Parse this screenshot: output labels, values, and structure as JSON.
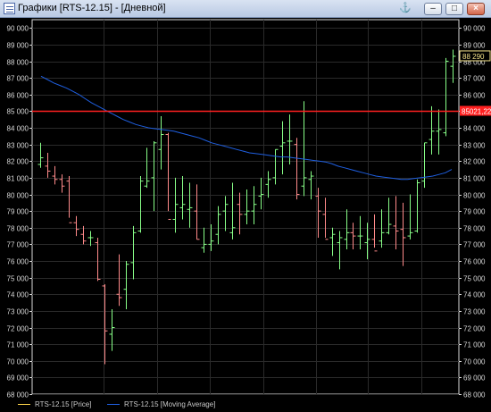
{
  "window": {
    "title": "Графики [RTS-12.15] - [Дневной]",
    "controls": {
      "anchor_icon": "anchor-icon",
      "minimize_icon": "minimize-icon",
      "restore_icon": "restore-icon",
      "close_icon": "close-icon"
    }
  },
  "colors": {
    "background": "#000000",
    "grid": "#2a2a2a",
    "axis": "#d8d8d8",
    "up": "#88ff88",
    "down": "#ff8a8a",
    "ma": "#1f5fe0",
    "level": "#ff2020"
  },
  "chart_data": {
    "type": "bar",
    "title": "",
    "ylim": [
      68000,
      90500
    ],
    "y_ticks": [
      "68 000",
      "69 000",
      "70 000",
      "71 000",
      "72 000",
      "73 000",
      "74 000",
      "75 000",
      "76 000",
      "77 000",
      "78 000",
      "79 000",
      "80 000",
      "81 000",
      "82 000",
      "83 000",
      "84 000",
      "85 000",
      "86 000",
      "87 000",
      "88 000",
      "89 000",
      "90 000"
    ],
    "grid": true,
    "series": [
      {
        "name": "RTS-12.15 [Price]",
        "ohlc": [
          [
            81800,
            83100,
            81600,
            82200
          ],
          [
            81700,
            82500,
            81000,
            81400
          ],
          [
            81100,
            81700,
            80600,
            80900
          ],
          [
            80900,
            81200,
            80100,
            80500
          ],
          [
            80800,
            81100,
            78600,
            78300
          ],
          [
            78300,
            78700,
            77500,
            77900
          ],
          [
            77600,
            78100,
            77000,
            77200
          ],
          [
            77400,
            77800,
            76900,
            77400
          ],
          [
            77100,
            77400,
            74800,
            74900
          ],
          [
            74500,
            74600,
            69800,
            71800
          ],
          [
            71600,
            73100,
            70600,
            72000
          ],
          [
            74000,
            76400,
            73300,
            73800
          ],
          [
            74300,
            76000,
            73100,
            75800
          ],
          [
            75900,
            78100,
            74900,
            77700
          ],
          [
            77800,
            81100,
            77700,
            80800
          ],
          [
            80500,
            82800,
            80400,
            80800
          ],
          [
            81000,
            83200,
            79000,
            83100
          ],
          [
            82700,
            84700,
            81500,
            83600
          ],
          [
            83600,
            83700,
            79000,
            78500
          ],
          [
            78500,
            81000,
            77700,
            79400
          ],
          [
            79200,
            81100,
            78500,
            79400
          ],
          [
            79100,
            80700,
            78000,
            79200
          ],
          [
            79000,
            80600,
            77300,
            77300
          ],
          [
            76800,
            78000,
            76500,
            77000
          ],
          [
            77000,
            78200,
            76600,
            77200
          ],
          [
            77600,
            79300,
            77000,
            78800
          ],
          [
            79000,
            79900,
            77800,
            79400
          ],
          [
            77700,
            80700,
            77300,
            78000
          ],
          [
            79400,
            80100,
            77600,
            78800
          ],
          [
            78800,
            80300,
            78200,
            79000
          ],
          [
            79000,
            80500,
            78200,
            79400
          ],
          [
            79900,
            81000,
            79100,
            80000
          ],
          [
            80600,
            81400,
            79800,
            80900
          ],
          [
            81000,
            82700,
            80600,
            82700
          ],
          [
            82900,
            84400,
            81200,
            83100
          ],
          [
            83200,
            84800,
            81800,
            83200
          ],
          [
            83000,
            83400,
            79700,
            80000
          ],
          [
            80500,
            85600,
            79900,
            81000
          ],
          [
            80900,
            81400,
            79700,
            81100
          ],
          [
            79900,
            80400,
            77400,
            79000
          ],
          [
            78800,
            79800,
            77400,
            77300
          ],
          [
            77400,
            78000,
            76300,
            77600
          ],
          [
            77100,
            77800,
            75500,
            77400
          ],
          [
            77300,
            79100,
            76700,
            77700
          ],
          [
            77700,
            78300,
            76700,
            77500
          ],
          [
            77500,
            78700,
            76700,
            77500
          ],
          [
            77100,
            78300,
            76100,
            77300
          ],
          [
            77300,
            78800,
            76800,
            76600
          ],
          [
            77200,
            79100,
            76800,
            77700
          ],
          [
            77700,
            79800,
            77600,
            78200
          ],
          [
            78100,
            79900,
            76700,
            77800
          ],
          [
            77900,
            79500,
            75700,
            77400
          ],
          [
            77500,
            80000,
            77300,
            77700
          ],
          [
            77800,
            80900,
            77700,
            80700
          ],
          [
            80800,
            83100,
            80400,
            83100
          ],
          [
            83300,
            85300,
            82400,
            83800
          ],
          [
            83800,
            85100,
            82400,
            83900
          ],
          [
            83700,
            88200,
            83500,
            88000
          ],
          [
            87700,
            88700,
            86700,
            88300
          ]
        ]
      },
      {
        "name": "RTS-12.15 [Moving Average]",
        "ma": [
          87100,
          86900,
          86700,
          86550,
          86400,
          86200,
          86000,
          85750,
          85500,
          85300,
          85100,
          84900,
          84700,
          84500,
          84350,
          84200,
          84100,
          84000,
          83950,
          83900,
          83850,
          83800,
          83700,
          83600,
          83500,
          83400,
          83250,
          83100,
          83000,
          82900,
          82800,
          82700,
          82600,
          82500,
          82450,
          82400,
          82350,
          82300,
          82250,
          82250,
          82200,
          82150,
          82100,
          82050,
          82000,
          81950,
          81850,
          81700,
          81600,
          81500,
          81400,
          81300,
          81200,
          81100,
          81050,
          81000,
          80950,
          80900,
          80900,
          80950,
          81000,
          81050,
          81100,
          81200,
          81300,
          81500
        ]
      }
    ],
    "annotations": {
      "last_price_label": "88 290",
      "level_label": "85021,22",
      "level_value": 85021.22
    }
  }
}
